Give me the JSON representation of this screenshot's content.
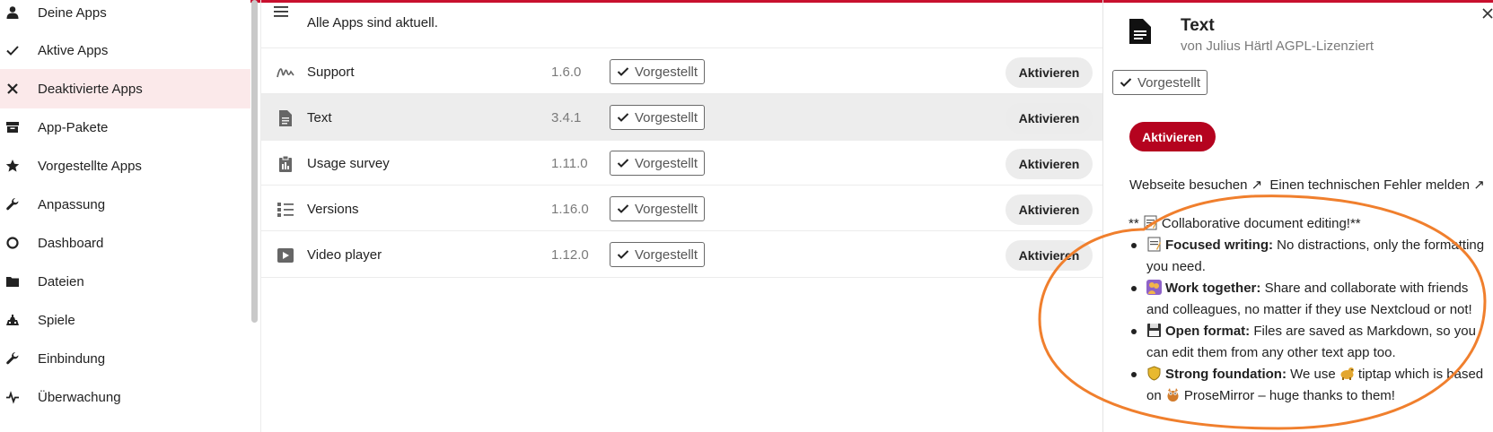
{
  "sidebar": {
    "items": [
      {
        "label": "Deine Apps",
        "icon": "user-icon"
      },
      {
        "label": "Aktive Apps",
        "icon": "check-icon"
      },
      {
        "label": "Deaktivierte Apps",
        "icon": "close-icon",
        "active": true
      },
      {
        "label": "App-Pakete",
        "icon": "archive-icon"
      },
      {
        "label": "Vorgestellte Apps",
        "icon": "star-icon"
      },
      {
        "label": "Anpassung",
        "icon": "wrench-icon"
      },
      {
        "label": "Dashboard",
        "icon": "circle-icon"
      },
      {
        "label": "Dateien",
        "icon": "folder-icon"
      },
      {
        "label": "Spiele",
        "icon": "gamepad-icon"
      },
      {
        "label": "Einbindung",
        "icon": "wrench-icon"
      },
      {
        "label": "Überwachung",
        "icon": "pulse-icon"
      }
    ]
  },
  "main": {
    "status": "Alle Apps sind aktuell.",
    "apps": [
      {
        "name": "Support",
        "version": "1.6.0",
        "badge": "Vorgestellt",
        "action": "Aktivieren",
        "icon": "signature-icon"
      },
      {
        "name": "Text",
        "version": "3.4.1",
        "badge": "Vorgestellt",
        "action": "Aktivieren",
        "icon": "document-icon",
        "selected": true
      },
      {
        "name": "Usage survey",
        "version": "1.11.0",
        "badge": "Vorgestellt",
        "action": "Aktivieren",
        "icon": "clipboard-icon"
      },
      {
        "name": "Versions",
        "version": "1.16.0",
        "badge": "Vorgestellt",
        "action": "Aktivieren",
        "icon": "list-icon"
      },
      {
        "name": "Video player",
        "version": "1.12.0",
        "badge": "Vorgestellt",
        "action": "Aktivieren",
        "icon": "play-icon"
      }
    ]
  },
  "detail": {
    "title": "Text",
    "subtitle": "von Julius Härtl AGPL-Lizenziert",
    "badge": "Vorgestellt",
    "action": "Aktivieren",
    "link_website": "Webseite besuchen ↗",
    "link_bug": "Einen technischen Fehler melden ↗",
    "intro_prefix": "** ",
    "intro_text": "Collaborative document editing!**",
    "features": [
      {
        "emoji": "memo-emoji",
        "title": "Focused writing:",
        "text": "No distractions, only the formatting you need."
      },
      {
        "emoji": "people-emoji",
        "title": "Work together:",
        "text": "Share and collaborate with friends and colleagues, no matter if they use Nextcloud or not!"
      },
      {
        "emoji": "floppy-emoji",
        "title": "Open format:",
        "text": "Files are saved as Markdown, so you can edit them from any other text app too."
      },
      {
        "emoji": "shield-emoji",
        "title": "Strong foundation:",
        "text_a": "We use",
        "text_b": "tiptap which is based on",
        "text_c": "ProseMirror – huge thanks to them!"
      }
    ]
  },
  "colors": {
    "accent": "#b5031f",
    "topbar": "#c8102e",
    "active_nav": "#fbe9ea",
    "annotation": "#f07f2d"
  }
}
